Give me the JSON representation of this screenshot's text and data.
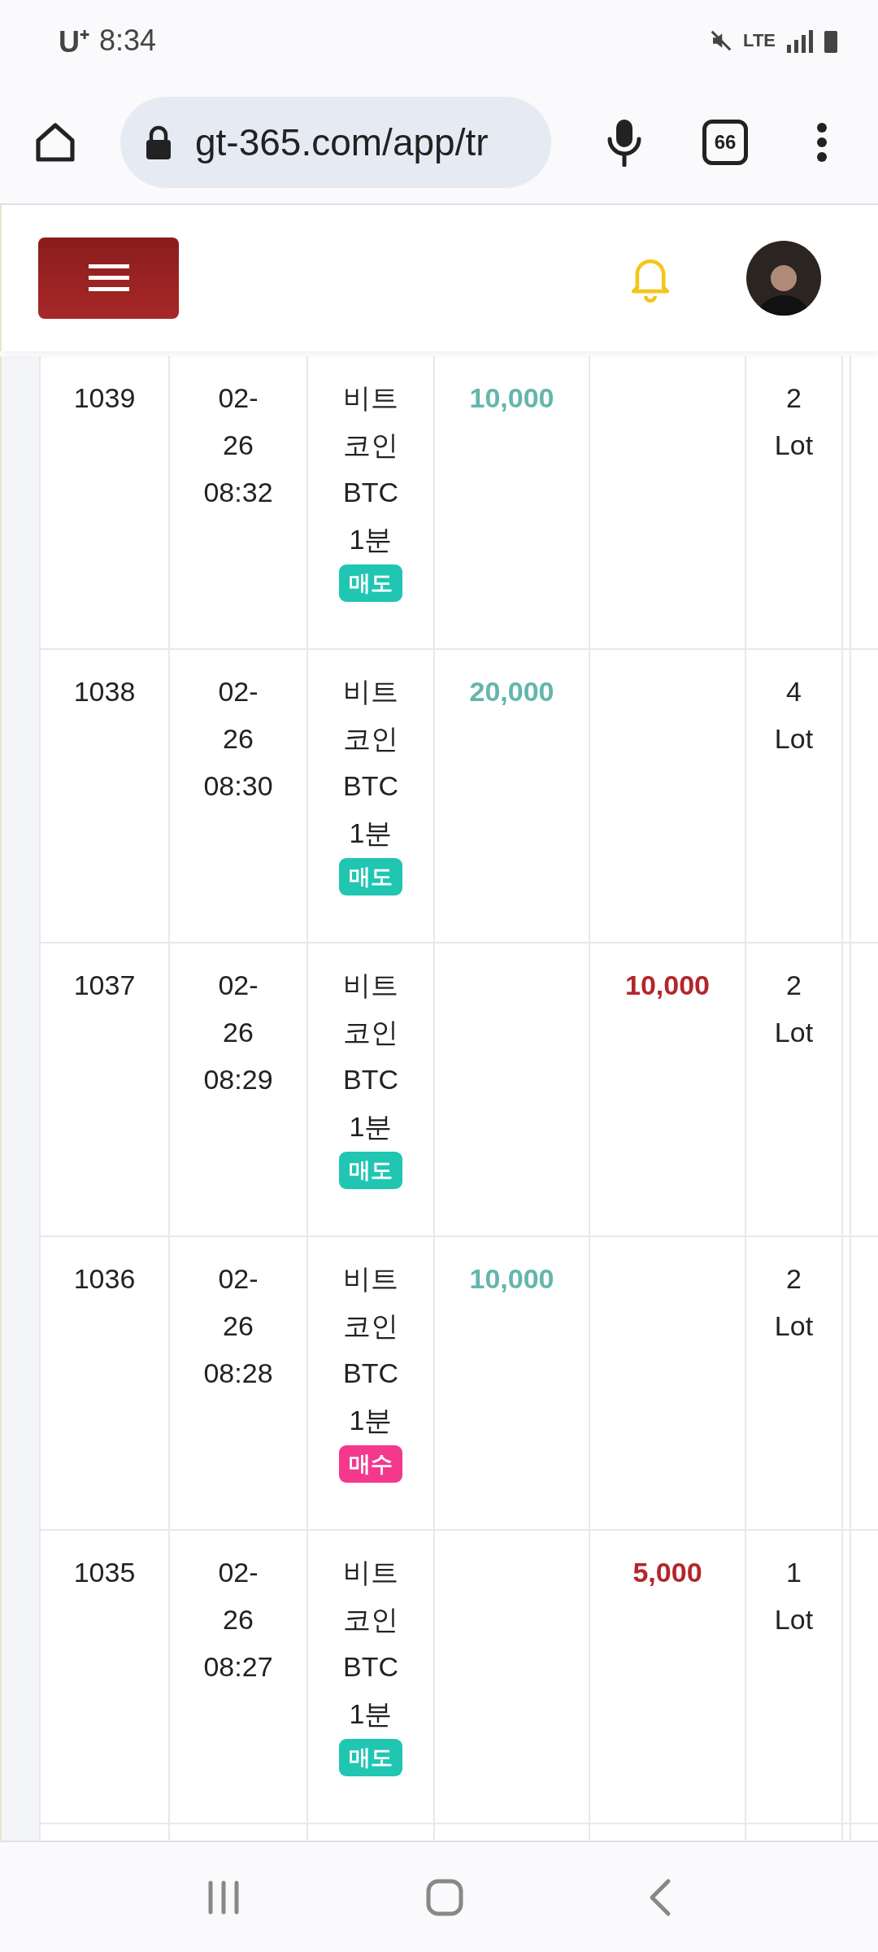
{
  "status_bar": {
    "carrier": "U⁺",
    "time": "8:34",
    "network": "LTE"
  },
  "browser": {
    "url": "gt-365.com/app/tr",
    "tab_count": "66"
  },
  "table": {
    "rows": [
      {
        "column_1": "1039",
        "column_2": "02-\n26\n08:32",
        "column_3": "비트\n코인\nBTC\n1분",
        "badge": {
          "kind": "sell",
          "label": "매도"
        },
        "column_4": "10,000",
        "column_5": "",
        "column_6": "2\nLot"
      },
      {
        "column_1": "1038",
        "column_2": "02-\n26\n08:30",
        "column_3": "비트\n코인\nBTC\n1분",
        "badge": {
          "kind": "sell",
          "label": "매도"
        },
        "column_4": "20,000",
        "column_5": "",
        "column_6": "4\nLot"
      },
      {
        "column_1": "1037",
        "column_2": "02-\n26\n08:29",
        "column_3": "비트\n코인\nBTC\n1분",
        "badge": {
          "kind": "sell",
          "label": "매도"
        },
        "column_4": "",
        "column_5": "10,000",
        "column_6": "2\nLot"
      },
      {
        "column_1": "1036",
        "column_2": "02-\n26\n08:28",
        "column_3": "비트\n코인\nBTC\n1분",
        "badge": {
          "kind": "buy",
          "label": "매수"
        },
        "column_4": "10,000",
        "column_5": "",
        "column_6": "2\nLot"
      },
      {
        "column_1": "1035",
        "column_2": "02-\n26\n08:27",
        "column_3": "비트\n코인\nBTC\n1분",
        "badge": {
          "kind": "sell",
          "label": "매도"
        },
        "column_4": "",
        "column_5": "5,000",
        "column_6": "1\nLot"
      }
    ]
  }
}
